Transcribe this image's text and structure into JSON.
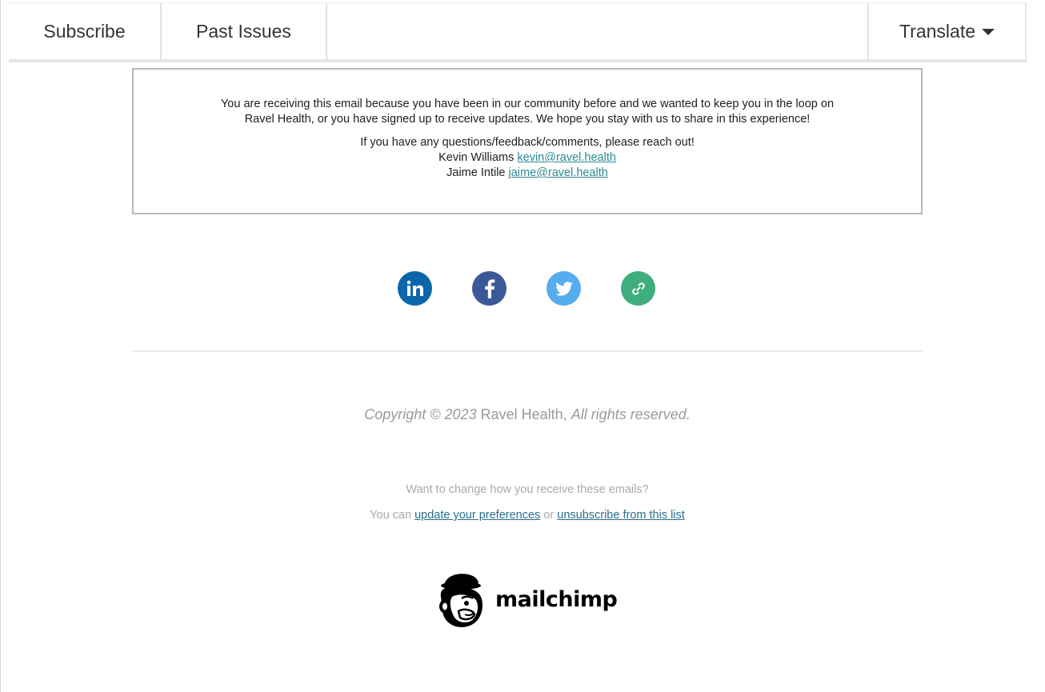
{
  "nav": {
    "subscribe": "Subscribe",
    "past_issues": "Past Issues",
    "translate": "Translate"
  },
  "notice": {
    "line1": "You are receiving this email because you have been in our community before and we wanted to keep you in the loop on",
    "line2": "Ravel Health, or you have signed up to receive updates. We hope you stay with us to share in this experience!",
    "line3": "If you have any questions/feedback/comments, please reach out!",
    "contact1_name": "Kevin Williams",
    "contact1_email": "kevin@ravel.health",
    "contact2_name": "Jaime Intile",
    "contact2_email": "jaime@ravel.health"
  },
  "social": [
    {
      "name": "linkedin",
      "color": "#0a66a9"
    },
    {
      "name": "facebook",
      "color": "#3b5998"
    },
    {
      "name": "twitter",
      "color": "#55acee"
    },
    {
      "name": "link",
      "color": "#3fae7f"
    }
  ],
  "footer": {
    "copyright_prefix": "Copyright © 2023",
    "company": "Ravel Health,",
    "rights": "All rights reserved.",
    "change_question": "Want to change how you receive these emails?",
    "you_can": "You can",
    "update_link": "update your preferences",
    "or": "or",
    "unsubscribe_link": "unsubscribe from this list"
  },
  "brand": {
    "name": "mailchimp"
  }
}
